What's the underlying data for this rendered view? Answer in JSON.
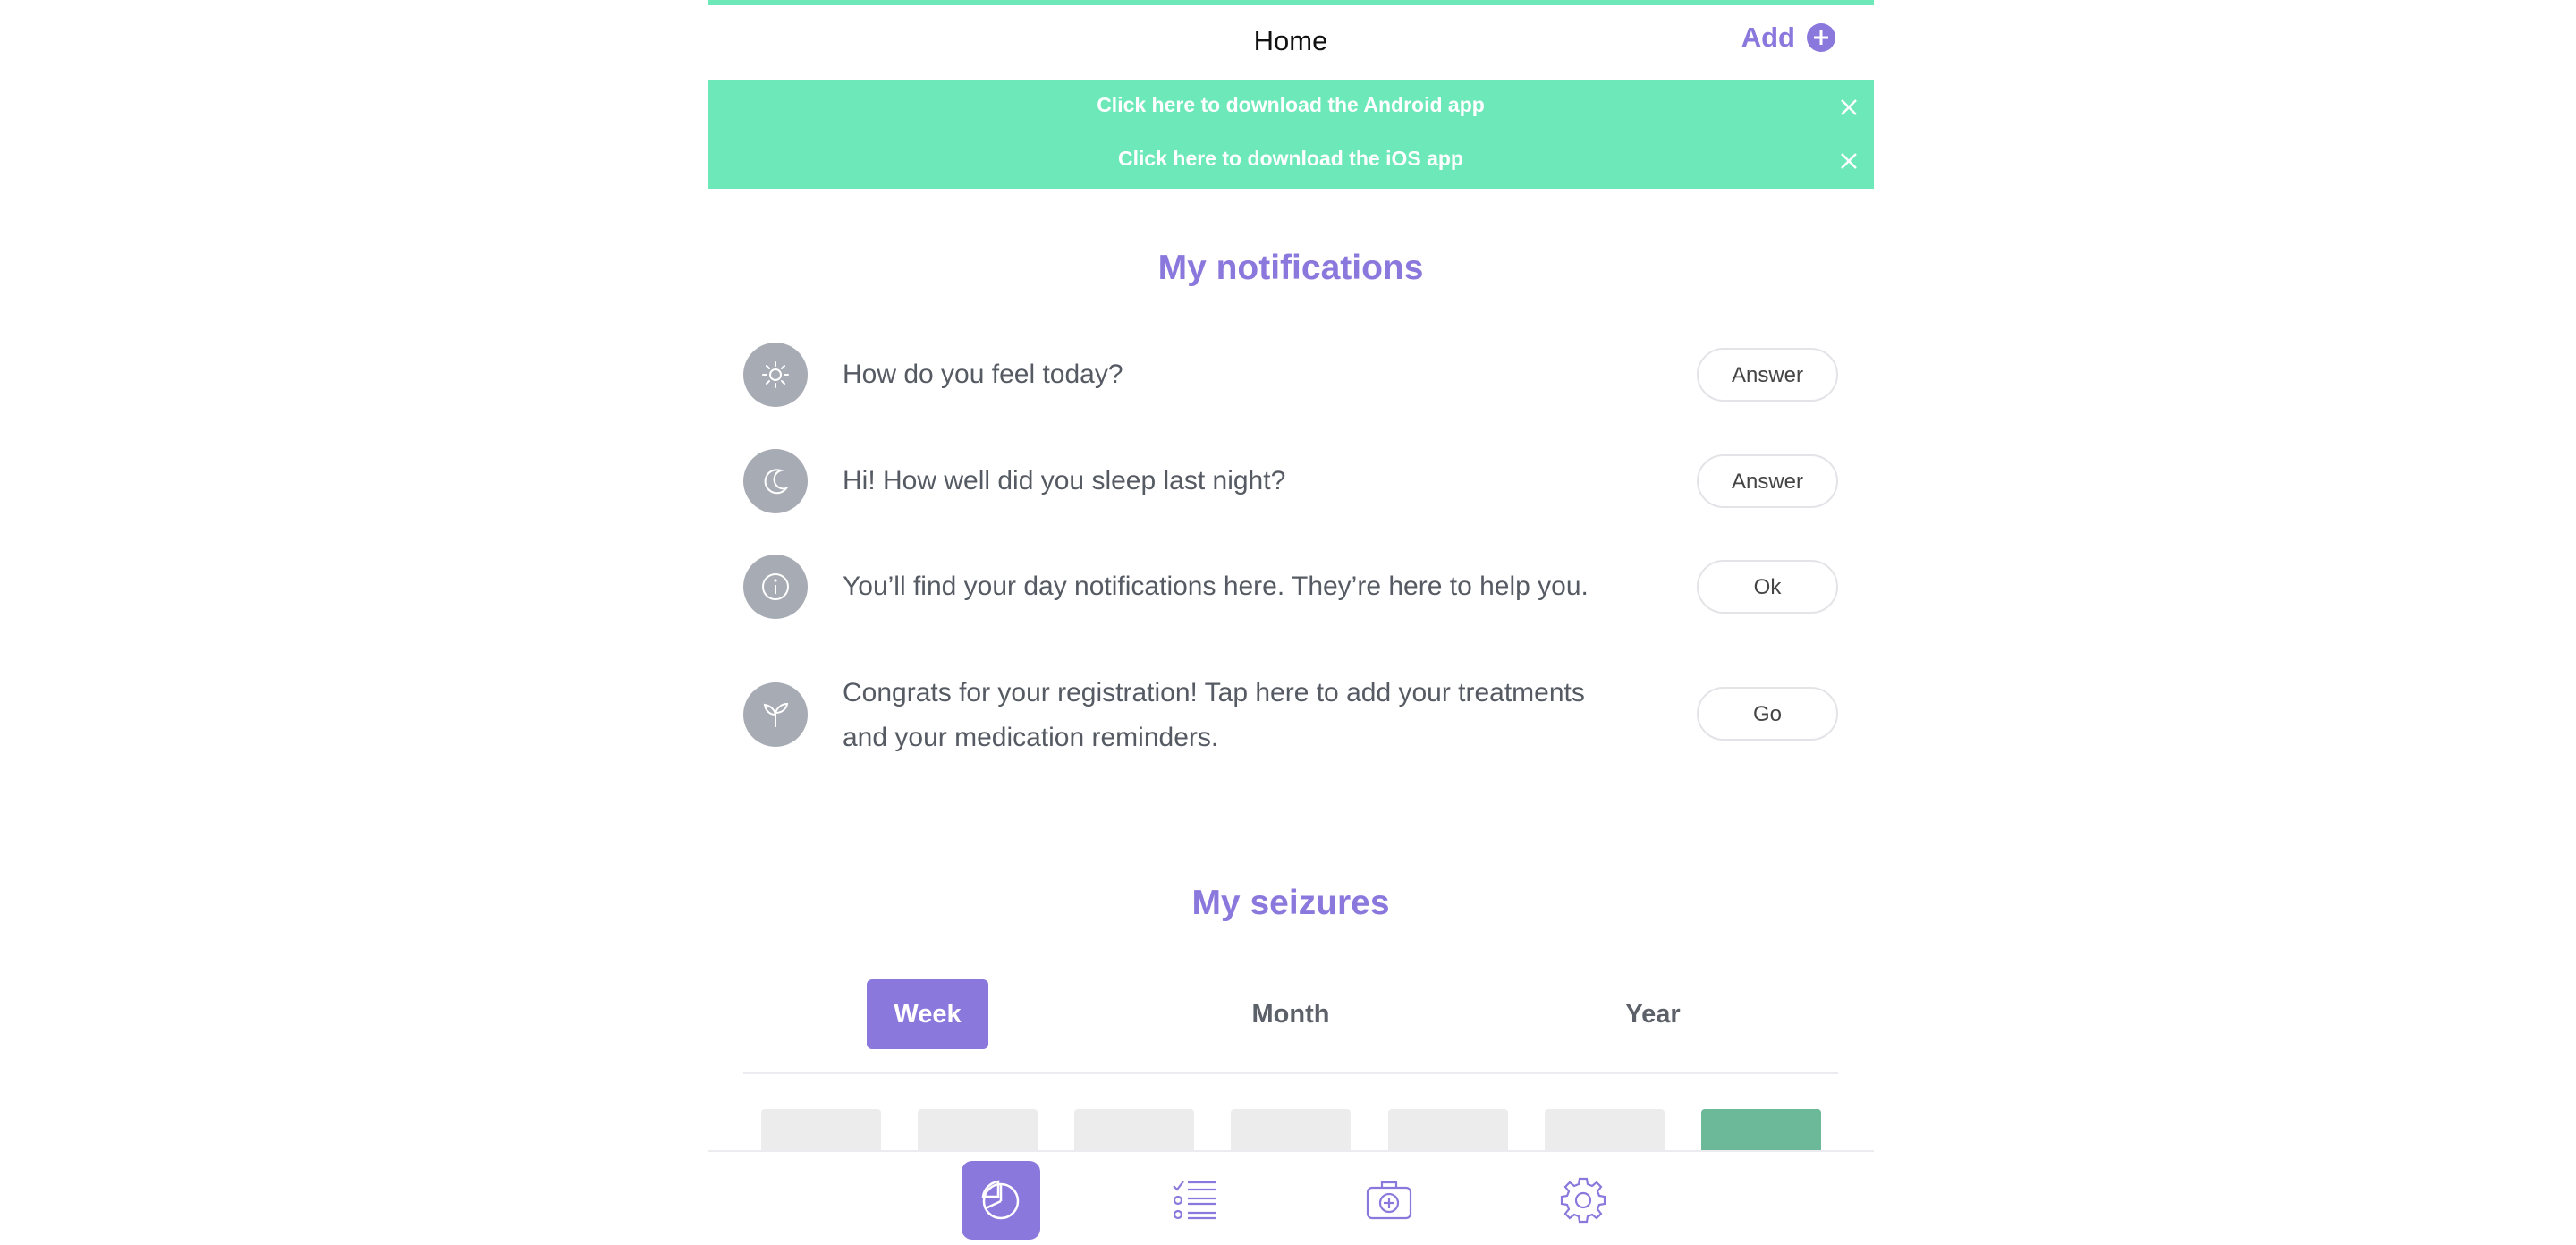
{
  "header": {
    "title": "Home",
    "add_label": "Add"
  },
  "banners": [
    {
      "text": "Click here to download the Android app"
    },
    {
      "text": "Click here to download the iOS app"
    }
  ],
  "notifications": {
    "title": "My notifications",
    "items": [
      {
        "icon": "sun-icon",
        "text": "How do you feel today?",
        "button": "Answer"
      },
      {
        "icon": "moon-icon",
        "text": "Hi! How well did you sleep last night?",
        "button": "Answer"
      },
      {
        "icon": "info-icon",
        "text": "You’ll find your day notifications here. They’re here to help you.",
        "button": "Ok"
      },
      {
        "icon": "plant-icon",
        "text": "Congrats for your registration! Tap here to add your treatments and your medication reminders.",
        "button": "Go"
      }
    ]
  },
  "seizures": {
    "title": "My seizures",
    "tabs": [
      "Week",
      "Month",
      "Year"
    ],
    "active_tab": "Week"
  },
  "colors": {
    "accent": "#8b78dc",
    "banner": "#6de8b9",
    "bar_today": "#6cb99a",
    "bar_empty": "#ececec"
  },
  "navbar": [
    "dashboard-icon",
    "checklist-icon",
    "medical-kit-icon",
    "settings-icon"
  ]
}
